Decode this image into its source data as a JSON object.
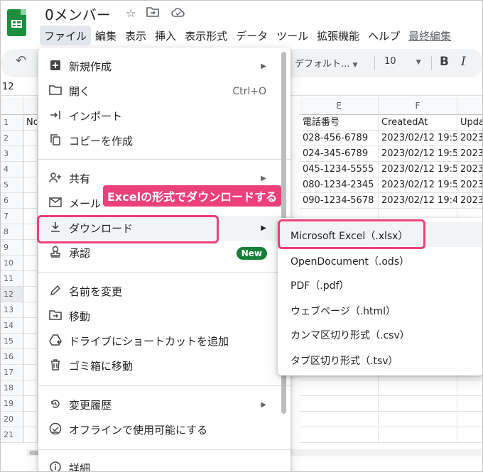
{
  "app": {
    "doc_title": "0メンバー",
    "menubar": [
      "ファイル",
      "編集",
      "表示",
      "挿入",
      "表示形式",
      "データ",
      "ツール",
      "拡張機能",
      "ヘルプ",
      "最終編集"
    ]
  },
  "toolbar": {
    "font": "デフォルト...",
    "font_size": "10",
    "bold": "B",
    "italic": "I"
  },
  "namebox": "12",
  "grid": {
    "col_e": "E",
    "col_f": "F",
    "headers": [
      "No",
      "電話番号",
      "CreatedAt",
      "Upda"
    ],
    "rows": [
      {
        "num": "1"
      },
      {
        "num": "2",
        "tel": "028-456-6789",
        "created": "2023/02/12 19:5",
        "upd": "2023"
      },
      {
        "num": "3",
        "tel": "024-345-6789",
        "created": "2023/02/12 19:5",
        "upd": "2023"
      },
      {
        "num": "4",
        "tel": "045-1234-5555",
        "created": "2023/02/12 19:5",
        "upd": "2023"
      },
      {
        "num": "5",
        "tel": "080-1234-2345",
        "created": "2023/02/12 19:5",
        "upd": "2023"
      },
      {
        "num": "6",
        "tel": "090-1234-5678",
        "created": "2023/02/12 19:4",
        "upd": "2023"
      },
      {
        "num": "7"
      },
      {
        "num": "8"
      },
      {
        "num": "9"
      },
      {
        "num": "10"
      },
      {
        "num": "11"
      },
      {
        "num": "12"
      },
      {
        "num": "13"
      },
      {
        "num": "14"
      },
      {
        "num": "15"
      },
      {
        "num": "16"
      },
      {
        "num": "17"
      },
      {
        "num": "18"
      },
      {
        "num": "19"
      },
      {
        "num": "20"
      },
      {
        "num": "21"
      }
    ]
  },
  "file_menu": {
    "new": "新規作成",
    "open": "開く",
    "open_shortcut": "Ctrl+O",
    "import": "インポート",
    "copy": "コピーを作成",
    "share": "共有",
    "email": "メール",
    "download": "ダウンロード",
    "approval": "承認",
    "new_badge": "New",
    "rename": "名前を変更",
    "move": "移動",
    "shortcut": "ドライブにショートカットを追加",
    "trash": "ゴミ箱に移動",
    "history": "変更履歴",
    "offline": "オフラインで使用可能にする",
    "details": "詳細"
  },
  "download_menu": {
    "items": [
      "Microsoft Excel（.xlsx）",
      "OpenDocument（.ods）",
      "PDF（.pdf）",
      "ウェブページ（.html）",
      "カンマ区切り形式（.csv）",
      "タブ区切り形式（.tsv）"
    ]
  },
  "annotation": {
    "callout": "Excelの形式でダウンロードする"
  },
  "colors": {
    "accent": "#ec407a",
    "sheets_green": "#1e8e3e",
    "badge_green": "#188038"
  }
}
